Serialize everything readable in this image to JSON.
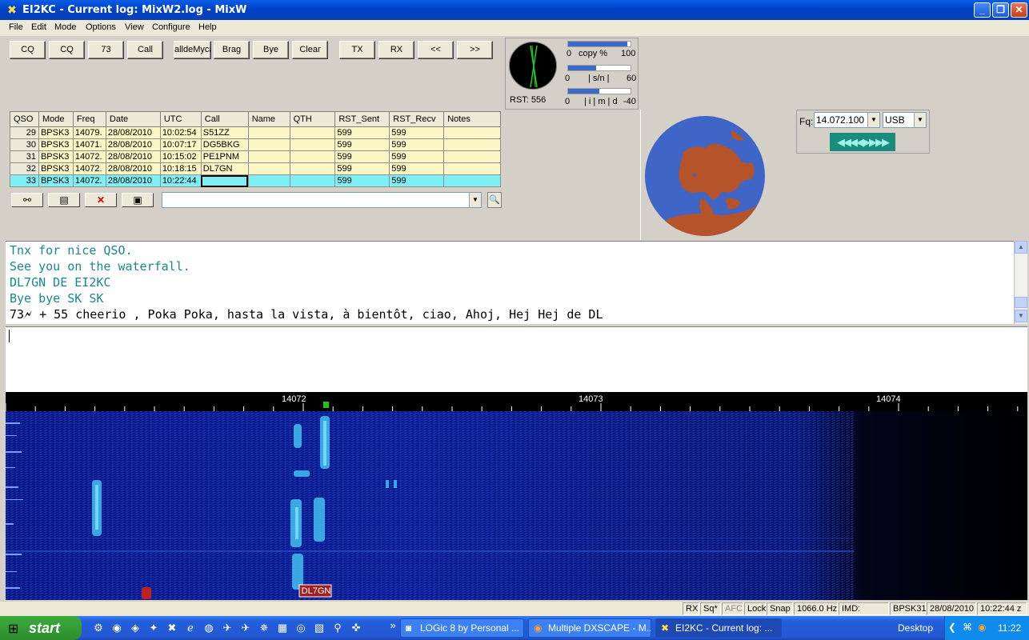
{
  "window": {
    "title": "EI2KC - Current log: MixW2.log - MixW",
    "min": "_",
    "max": "❐",
    "close": "✕"
  },
  "menu": [
    "File",
    "Edit",
    "Mode",
    "Options",
    "View",
    "Configure",
    "Help"
  ],
  "macros": [
    "CQ",
    "CQ",
    "73",
    "Call",
    "alldeMyca",
    "Brag",
    "Bye",
    "Clear",
    "TX",
    "RX",
    "<<",
    ">>"
  ],
  "scope": {
    "rst": "RST: 556",
    "copy": {
      "min": "0",
      "label": "copy %",
      "max": "100",
      "level": 0.95
    },
    "sn": {
      "min": "0",
      "label": "| s/n |",
      "max": "60",
      "level": 0.45
    },
    "imd": {
      "min": "0",
      "label": "| i | m | d",
      "max": "-40",
      "level": 0.5
    }
  },
  "log": {
    "columns": [
      "QSO",
      "Mode",
      "Freq",
      "Date",
      "UTC",
      "Call",
      "Name",
      "QTH",
      "RST_Sent",
      "RST_Recv",
      "Notes"
    ],
    "rows": [
      [
        "29",
        "BPSK3",
        "14079.",
        "28/08/2010",
        "10:02:54",
        "S51ZZ",
        "",
        "",
        "599",
        "599",
        ""
      ],
      [
        "30",
        "BPSK3",
        "14071.",
        "28/08/2010",
        "10:07:17",
        "DG5BKG",
        "",
        "",
        "599",
        "599",
        ""
      ],
      [
        "31",
        "BPSK3",
        "14072.",
        "28/08/2010",
        "10:15:02",
        "PE1PNM",
        "",
        "",
        "599",
        "599",
        ""
      ],
      [
        "32",
        "BPSK3",
        "14072.",
        "28/08/2010",
        "10:18:15",
        "DL7GN",
        "",
        "",
        "599",
        "599",
        ""
      ],
      [
        "33",
        "BPSK3",
        "14072.",
        "28/08/2010",
        "10:22:44",
        "",
        "",
        "",
        "599",
        "599",
        ""
      ]
    ],
    "tools": [
      "binoculars-icon",
      "form-icon",
      "delete-icon",
      "save-icon"
    ]
  },
  "freq": {
    "prefix": "Fq:",
    "value": "14.072.100",
    "mode": "USB",
    "tune": "◀◀◀◀▶▶▶▶"
  },
  "rx_text": [
    {
      "text": "Tnx for nice QSO.",
      "color": "teal"
    },
    {
      "text": "See you on the waterfall.",
      "color": "teal"
    },
    {
      "text": "DL7GN DE EI2KC",
      "color": "teal"
    },
    {
      "text": "Bye bye SK SK",
      "color": "teal"
    },
    {
      "text": "73🗲 + 55  cheerio , Poka Poka, hasta la vista, à bientôt, ciao, Ahoj, Hej Hej  de DL",
      "color": "black"
    }
  ],
  "waterfall": {
    "ticks": [
      "14072",
      "14073",
      "14074"
    ],
    "callsign_tag": "DL7GN"
  },
  "status": [
    "RX",
    "Sq*",
    "AFC",
    "Lock",
    "Snap",
    "1066.0 Hz",
    "IMD:",
    "BPSK31",
    "28/08/2010",
    "10:22:44 z"
  ],
  "taskbar": {
    "start": "start",
    "tasks": [
      "LOGic 8 by Personal ...",
      "Multiple DXSCAPE - M...",
      "EI2KC - Current log: ..."
    ],
    "desktop": "Desktop",
    "clock": "11:22",
    "more": "»"
  }
}
